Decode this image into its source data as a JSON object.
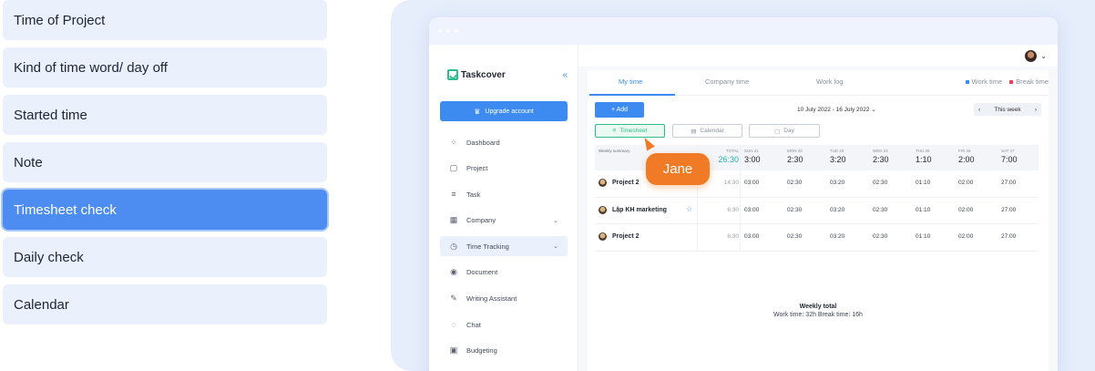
{
  "features": [
    {
      "label": "Time of Project"
    },
    {
      "label": "Kind of time word/ day off"
    },
    {
      "label": "Started time"
    },
    {
      "label": "Note"
    },
    {
      "label": "Timesheet check"
    },
    {
      "label": "Daily check"
    },
    {
      "label": "Calendar"
    }
  ],
  "active_feature": "Timesheet check",
  "app": {
    "logo_text": "Taskcover",
    "upgrade_label": "Upgrade account",
    "nav": [
      {
        "label": "Dashboard",
        "icon": "grid-icon"
      },
      {
        "label": "Project",
        "icon": "project-icon"
      },
      {
        "label": "Task",
        "icon": "list-icon"
      },
      {
        "label": "Company",
        "icon": "company-icon"
      },
      {
        "label": "Time Tracking",
        "icon": "clock-icon"
      },
      {
        "label": "Document",
        "icon": "document-icon"
      },
      {
        "label": "Writing Assistant",
        "icon": "writing-icon"
      },
      {
        "label": "Chat",
        "icon": "chat-icon"
      },
      {
        "label": "Budgeting",
        "icon": "budget-icon"
      }
    ],
    "tabs": [
      {
        "label": "My time"
      },
      {
        "label": "Company time"
      },
      {
        "label": "Work log"
      }
    ],
    "legend": {
      "work": "Work time",
      "break": "Break time",
      "work_color": "#3d8bf0",
      "break_color": "#e8425a"
    },
    "add_label": "+ Add",
    "date_range": "10 July 2022 - 16 July 2022",
    "week_label": "This week",
    "views": [
      {
        "label": "Timesheet"
      },
      {
        "label": "Calendar"
      },
      {
        "label": "Day"
      }
    ],
    "table": {
      "summary_label": "Weekly summary",
      "headers": [
        {
          "label": "TOTAL",
          "value": "26:30"
        },
        {
          "label": "SUN 21",
          "value": "3:00"
        },
        {
          "label": "MON 22",
          "value": "2:30"
        },
        {
          "label": "TUE 23",
          "value": "3:20"
        },
        {
          "label": "WED 24",
          "value": "2:30"
        },
        {
          "label": "THU 25",
          "value": "1:10"
        },
        {
          "label": "FRI 26",
          "value": "2:00"
        },
        {
          "label": "SAT 27",
          "value": "7:00"
        }
      ],
      "rows": [
        {
          "name": "Project 2",
          "cells": [
            "14:30",
            "03:00",
            "02:30",
            "03:20",
            "02:30",
            "01:10",
            "02:00",
            "27:00"
          ]
        },
        {
          "name": "Lập KH marketing",
          "cells": [
            "6:30",
            "03:00",
            "02:30",
            "03:20",
            "02:30",
            "01:10",
            "02:00",
            "27:00"
          ]
        },
        {
          "name": "Project 2",
          "cells": [
            "6:30",
            "03:00",
            "02:30",
            "03:20",
            "02:30",
            "01:10",
            "02:00",
            "27:00"
          ]
        }
      ]
    },
    "weekly_total": {
      "title": "Weekly total",
      "summary": "Work time: 32h   Break time: 16h"
    }
  },
  "cursor_user": "Jane",
  "colors": {
    "accent": "#3d8bf0",
    "cursor": "#f07a26",
    "active_feature": "#4d8df2",
    "timesheet_green": "#2ebd8c"
  }
}
